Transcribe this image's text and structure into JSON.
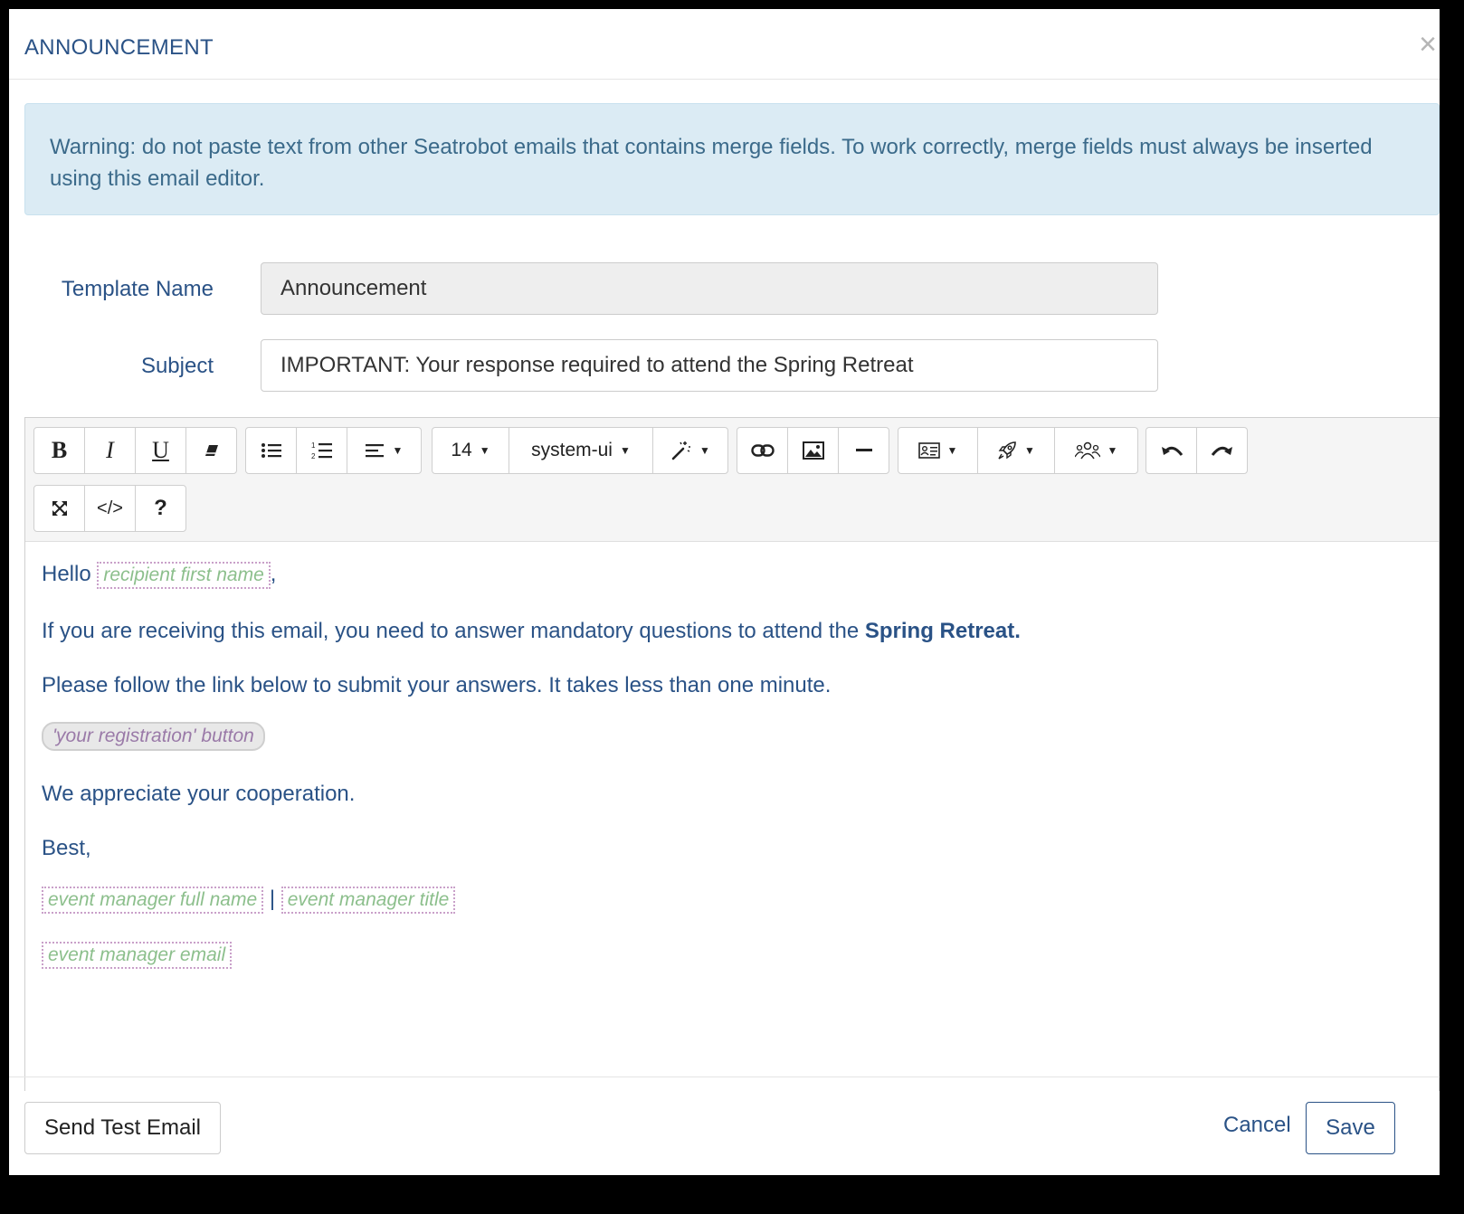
{
  "modal": {
    "title": "ANNOUNCEMENT",
    "close_symbol": "×"
  },
  "warning": {
    "text": "Warning: do not paste text from other Seatrobot emails that contains merge fields. To work correctly, merge fields must always be inserted using this email editor."
  },
  "form": {
    "template_name_label": "Template Name",
    "template_name_value": "Announcement",
    "subject_label": "Subject",
    "subject_value": "IMPORTANT: Your response required to attend the Spring Retreat"
  },
  "toolbar": {
    "bold": "B",
    "italic": "I",
    "underline": "U",
    "font_size": "14",
    "font_family": "system-ui",
    "code_view": "</>",
    "help": "?",
    "icons": [
      "bold-icon",
      "italic-icon",
      "underline-icon",
      "eraser-icon",
      "unordered-list-icon",
      "ordered-list-icon",
      "align-icon",
      "magic-wand-icon",
      "link-icon",
      "image-icon",
      "horizontal-rule-icon",
      "contact-card-icon",
      "rocket-icon",
      "people-icon",
      "undo-icon",
      "redo-icon",
      "fullscreen-icon",
      "code-icon",
      "help-icon"
    ]
  },
  "body": {
    "greeting": "Hello",
    "greeting_merge": "recipient first name",
    "greeting_comma": ",",
    "para1_text": "If you are receiving this email, you need to answer mandatory questions to attend the",
    "para1_bold": "Spring Retreat.",
    "para2": "Please follow the link below to submit your answers. It takes less than one minute.",
    "registration_button": "'your registration' button",
    "para3": "We appreciate your cooperation.",
    "closing": "Best,",
    "manager_name": "event manager full name",
    "separator": "|",
    "manager_title": "event manager title",
    "manager_email": "event manager email"
  },
  "footer": {
    "send_test": "Send Test Email",
    "cancel": "Cancel",
    "save": "Save"
  },
  "colors": {
    "brand_text": "#2a5286",
    "warning_bg": "#dbebf4",
    "merge_field_text": "#8cbf8c",
    "merge_field_border": "#c9a0c9"
  }
}
